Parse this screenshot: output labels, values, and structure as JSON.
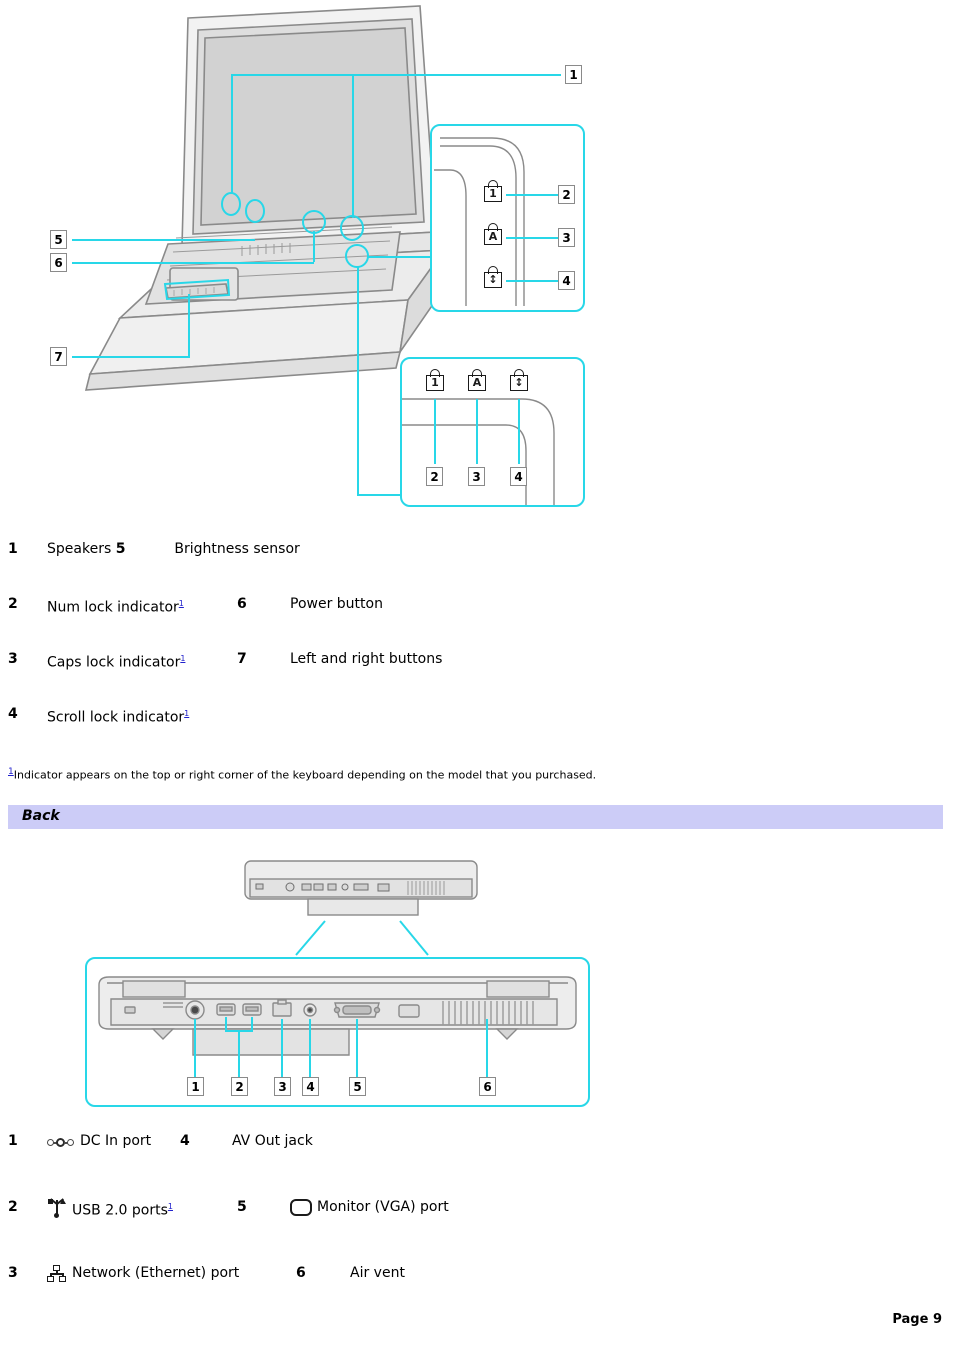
{
  "page": {
    "footer_label": "Page 9"
  },
  "top_diagram": {
    "name": "laptop-open-front-view",
    "callouts": [
      "1",
      "2",
      "3",
      "4",
      "5",
      "6",
      "7"
    ],
    "detail_panel_right": {
      "indicators": [
        {
          "glyph": "1",
          "icon": "num-lock-icon",
          "callout": "2"
        },
        {
          "glyph": "A",
          "icon": "caps-lock-icon",
          "callout": "3"
        },
        {
          "glyph": "↕",
          "icon": "scroll-lock-icon",
          "callout": "4"
        }
      ]
    },
    "detail_panel_bottom": {
      "indicators": [
        {
          "glyph": "1",
          "icon": "num-lock-icon",
          "callout": "2"
        },
        {
          "glyph": "A",
          "icon": "caps-lock-icon",
          "callout": "3"
        },
        {
          "glyph": "↕",
          "icon": "scroll-lock-icon",
          "callout": "4"
        }
      ]
    }
  },
  "front_items": [
    {
      "num": "1",
      "label": "Speakers",
      "num2": "5",
      "label2": "Brightness sensor",
      "fn": false,
      "inline": true
    },
    {
      "num": "2",
      "label": "Num lock indicator",
      "num2": "6",
      "label2": "Power button",
      "fn": true,
      "inline": false
    },
    {
      "num": "3",
      "label": "Caps lock indicator",
      "num2": "7",
      "label2": "Left and right buttons",
      "fn": true,
      "inline": false
    },
    {
      "num": "4",
      "label": "Scroll lock indicator",
      "num2": "",
      "label2": "",
      "fn": true,
      "inline": false
    }
  ],
  "footnote": {
    "marker": "1",
    "text": "Indicator appears on the top or right corner of the keyboard depending on the model that you purchased."
  },
  "section": {
    "title": "Back"
  },
  "back_diagram": {
    "name": "laptop-rear-view",
    "callouts": [
      "1",
      "2",
      "3",
      "4",
      "5",
      "6"
    ]
  },
  "back_items": [
    {
      "num": "1",
      "icon": "dc-in-icon",
      "label": "DC In port",
      "fn": false,
      "num2": "4",
      "label2": "AV Out jack",
      "icon2": ""
    },
    {
      "num": "2",
      "icon": "usb-icon",
      "label": "USB 2.0 ports",
      "fn": true,
      "num2": "5",
      "label2": "Monitor (VGA) port",
      "icon2": "vga-icon"
    },
    {
      "num": "3",
      "icon": "ethernet-icon",
      "label": "Network (Ethernet) port",
      "fn": false,
      "num2": "6",
      "label2": "Air vent",
      "icon2": ""
    }
  ],
  "colors": {
    "callout_line": "#28d7e8",
    "section_bar": "#ccccf7",
    "link": "#2222cc",
    "illustration_line": "#7a7a7a"
  }
}
